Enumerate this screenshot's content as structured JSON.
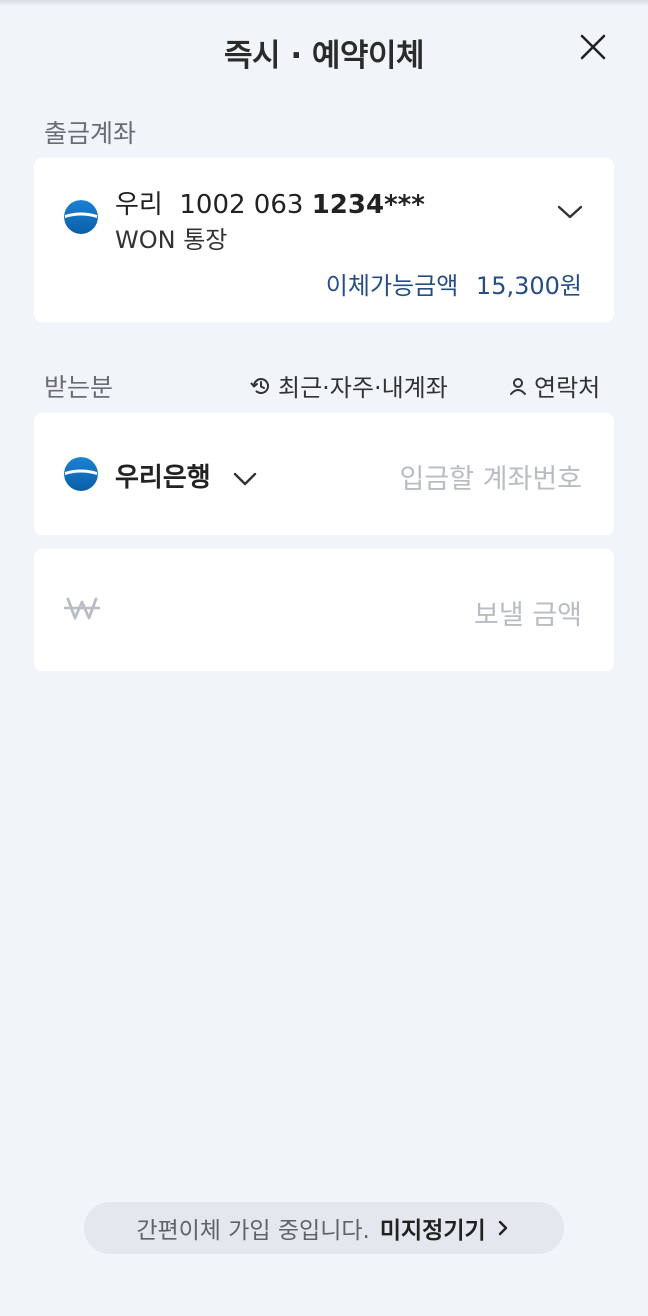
{
  "header": {
    "title": "즉시 · 예약이체"
  },
  "withdraw": {
    "section_label": "출금계좌",
    "bank_short": "우리",
    "account_prefix": "1002 063",
    "account_suffix": "1234***",
    "account_name": "WON 통장",
    "available_label": "이체가능금액",
    "available_amount": "15,300",
    "currency_unit": "원"
  },
  "recipient": {
    "section_label": "받는분",
    "recent_link": "최근·자주·내계좌",
    "contacts_link": "연락처",
    "bank_name": "우리은행",
    "account_placeholder": "입금할 계좌번호"
  },
  "amount": {
    "currency_symbol": "₩",
    "placeholder": "보낼 금액"
  },
  "banner": {
    "message": "간편이체 가입 중입니다.",
    "action": "미지정기기"
  },
  "colors": {
    "accent": "#264e84",
    "background": "#f1f4f9",
    "placeholder": "#b8bcc3",
    "bank_logo_blue": "#1a82d4"
  },
  "icons": [
    "close-icon",
    "chevron-down-icon",
    "history-icon",
    "person-icon",
    "won-icon",
    "chevron-right-icon",
    "woori-bank-logo"
  ]
}
